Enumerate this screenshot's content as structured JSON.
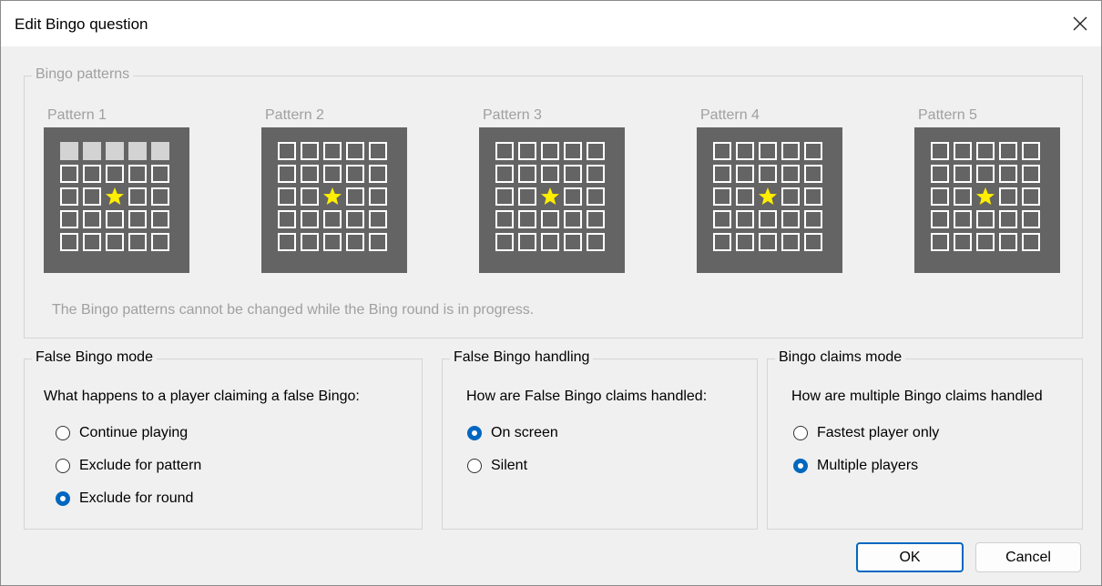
{
  "window": {
    "title": "Edit Bingo question"
  },
  "patterns_group": {
    "legend": "Bingo patterns",
    "patterns": [
      {
        "label": "Pattern 1",
        "filled_rows": [
          0
        ]
      },
      {
        "label": "Pattern 2",
        "filled_rows": []
      },
      {
        "label": "Pattern 3",
        "filled_rows": []
      },
      {
        "label": "Pattern 4",
        "filled_rows": []
      },
      {
        "label": "Pattern 5",
        "filled_rows": []
      }
    ],
    "note": "The Bingo patterns cannot be changed while the Bing round is in progress."
  },
  "false_mode": {
    "legend": "False Bingo mode",
    "question": "What happens to a player claiming a false Bingo:",
    "options": [
      {
        "label": "Continue playing",
        "checked": false
      },
      {
        "label": "Exclude for pattern",
        "checked": false
      },
      {
        "label": "Exclude for round",
        "checked": true
      }
    ]
  },
  "false_handling": {
    "legend": "False Bingo handling",
    "question": "How are False Bingo claims handled:",
    "options": [
      {
        "label": "On screen",
        "checked": true
      },
      {
        "label": "Silent",
        "checked": false
      }
    ]
  },
  "claims_mode": {
    "legend": "Bingo claims mode",
    "question": "How are multiple Bingo claims handled",
    "options": [
      {
        "label": "Fastest player only",
        "checked": false
      },
      {
        "label": "Multiple players",
        "checked": true
      }
    ]
  },
  "buttons": {
    "ok": "OK",
    "cancel": "Cancel"
  },
  "colors": {
    "accent": "#0067c0",
    "board": "#646464",
    "filled_cell": "#d3d3d3",
    "star": "#ffee00",
    "disabled_text": "#a0a0a0"
  }
}
